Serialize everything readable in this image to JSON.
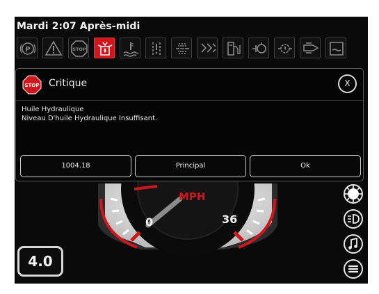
{
  "status_bar": {
    "time_text": "Mardi 2:07 Après-midi"
  },
  "warning_icons": [
    {
      "name": "park-brake-icon",
      "active": false
    },
    {
      "name": "warning-triangle-icon",
      "active": false
    },
    {
      "name": "stop-icon",
      "active": false
    },
    {
      "name": "hydraulic-oil-icon",
      "active": true
    },
    {
      "name": "coolant-temp-icon",
      "active": false
    },
    {
      "name": "pressure-icon",
      "active": false
    },
    {
      "name": "filter-icon",
      "active": false
    },
    {
      "name": "fan-icon",
      "active": false
    },
    {
      "name": "fuel-icon",
      "active": false
    },
    {
      "name": "engine-icon",
      "active": false
    },
    {
      "name": "oil-pressure-icon",
      "active": false
    },
    {
      "name": "transmission-icon",
      "active": false
    },
    {
      "name": "fluid-tank-icon",
      "active": false
    }
  ],
  "alert": {
    "stop_label": "STOP",
    "severity": "Critique",
    "close_label": "X",
    "line1": "Huile Hydraulique",
    "line2": "Niveau D'huile Hydraulique Insuffisant.",
    "buttons": {
      "code": "1004.18",
      "main": "Principal",
      "ok": "Ok"
    }
  },
  "gauge": {
    "unit": "MPH",
    "min_label": "0",
    "max_label": "36",
    "accent_color": "#d0161c"
  },
  "gear": {
    "value": "4.0"
  },
  "side_icons": [
    "brightness-icon",
    "headlight-icon",
    "music-icon",
    "menu-icon"
  ]
}
